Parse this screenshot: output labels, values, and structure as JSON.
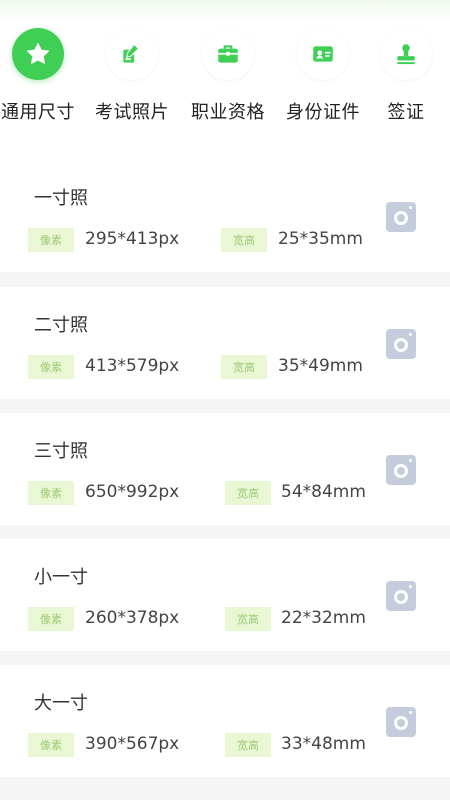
{
  "categories": [
    {
      "label": "通用尺寸",
      "icon": "star-icon",
      "active": true
    },
    {
      "label": "考试照片",
      "icon": "pen-icon",
      "active": false
    },
    {
      "label": "职业资格",
      "icon": "briefcase-icon",
      "active": false
    },
    {
      "label": "身份证件",
      "icon": "id-card-icon",
      "active": false
    },
    {
      "label": "签证",
      "icon": "stamp-icon",
      "active": false
    }
  ],
  "sizes": [
    {
      "name": "一寸照",
      "pixel_label": "像素",
      "pixels": "295*413px",
      "size_label": "宽高",
      "size": "25*35mm"
    },
    {
      "name": "二寸照",
      "pixel_label": "像素",
      "pixels": "413*579px",
      "size_label": "宽高",
      "size": "35*49mm"
    },
    {
      "name": "三寸照",
      "pixel_label": "像素",
      "pixels": "650*992px",
      "size_label": "宽高",
      "size": "54*84mm"
    },
    {
      "name": "小一寸",
      "pixel_label": "像素",
      "pixels": "260*378px",
      "size_label": "宽高",
      "size": "22*32mm"
    },
    {
      "name": "大一寸",
      "pixel_label": "像素",
      "pixels": "390*567px",
      "size_label": "宽高",
      "size": "33*48mm"
    }
  ],
  "colors": {
    "accent": "#3fcf55",
    "tag_bg": "#eaf7d4",
    "tag_text": "#9ccb74",
    "camera": "#c5cddc"
  }
}
